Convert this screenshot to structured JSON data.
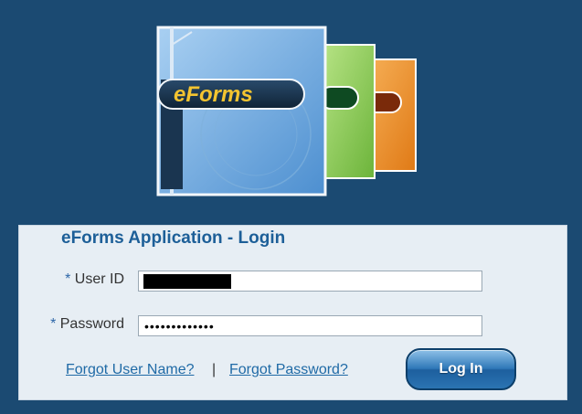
{
  "logo": {
    "text": "eForms"
  },
  "login": {
    "title": "eForms Application - Login",
    "required_marker": "*",
    "user_id_label": "User ID",
    "password_label": "Password",
    "password_value": "•••••••••••••",
    "forgot_user_name": "Forgot User Name?",
    "link_separator": "|",
    "forgot_password": "Forgot Password?",
    "login_button": "Log In"
  },
  "colors": {
    "page_background": "#1b4a72",
    "panel_background": "#e7eef4",
    "title": "#1d5f98",
    "link": "#1f6aa6",
    "button": "#2f78b8"
  }
}
